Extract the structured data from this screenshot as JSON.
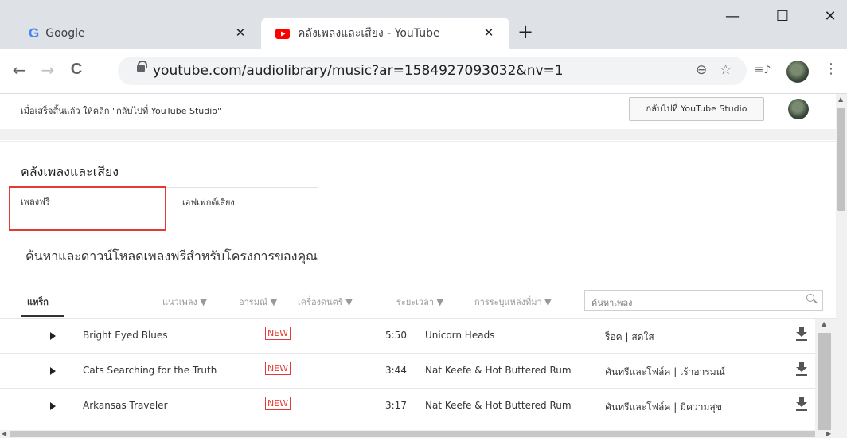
{
  "browser": {
    "tabs": [
      {
        "label": "Google",
        "icon": "google-g-icon"
      },
      {
        "label": "คลังเพลงและเสียง - YouTube",
        "icon": "youtube-icon"
      }
    ],
    "close_glyph": "✕",
    "new_tab_glyph": "+",
    "window": {
      "minimize": "—",
      "maximize": "☐",
      "close": "✕"
    },
    "nav": {
      "back": "←",
      "forward": "→",
      "reload": "C"
    },
    "url": "youtube.com/audiolibrary/music?ar=1584927093032&nv=1",
    "zoom_glyph": "⊖",
    "star_glyph": "☆",
    "queue_glyph": "≡♪",
    "menu_glyph": "⋮",
    "accent": "#e53935"
  },
  "studio": {
    "message": "เมื่อเสร็จสิ้นแล้ว ให้คลิก \"กลับไปที่ YouTube Studio\"",
    "back_button": "กลับไปที่ YouTube Studio"
  },
  "library": {
    "title": "คลังเพลงและเสียง",
    "tabs": [
      {
        "label": "เพลงฟรี",
        "active": true
      },
      {
        "label": "เอฟเฟกต์เสียง",
        "active": false
      }
    ],
    "subtitle": "ค้นหาและดาวน์โหลดเพลงฟรีสำหรับโครงการของคุณ",
    "filters": {
      "track": "แทร็ก",
      "genre": "แนวเพลง ▼",
      "mood": "อารมณ์ ▼",
      "instrument": "เครื่องดนตรี ▼",
      "duration": "ระยะเวลา ▼",
      "attribution": "การระบุแหล่งที่มา ▼"
    },
    "search_placeholder": "ค้นหาเพลง",
    "new_badge": "NEW",
    "tracks": [
      {
        "title": "Bright Eyed Blues",
        "duration": "5:50",
        "artist": "Unicorn Heads",
        "genre": "ร็อค | สดใส"
      },
      {
        "title": "Cats Searching for the Truth",
        "duration": "3:44",
        "artist": "Nat Keefe & Hot Buttered Rum",
        "genre": "คันทรีและโฟล์ค | เร้าอารมณ์"
      },
      {
        "title": "Arkansas Traveler",
        "duration": "3:17",
        "artist": "Nat Keefe & Hot Buttered Rum",
        "genre": "คันทรีและโฟล์ค | มีความสุข"
      }
    ]
  }
}
